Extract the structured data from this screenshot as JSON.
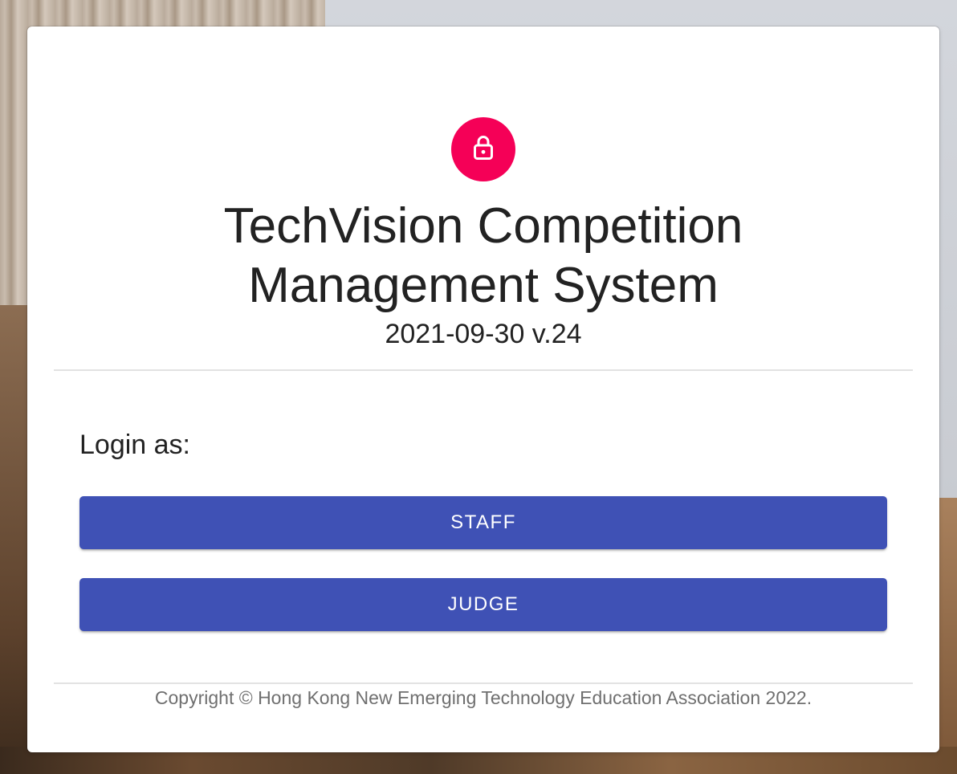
{
  "app": {
    "title_line1": "TechVision Competition",
    "title_line2": "Management System",
    "version": "2021-09-30 v.24"
  },
  "login": {
    "prompt": "Login as:",
    "buttons": [
      {
        "label": "STAFF"
      },
      {
        "label": "JUDGE"
      }
    ]
  },
  "footer": {
    "copyright": "Copyright © Hong Kong New Emerging Technology Education Association 2022."
  },
  "icons": {
    "avatar": "lock-icon"
  },
  "colors": {
    "avatar_bg": "#f50057",
    "button_bg": "#3f51b5",
    "button_text": "#ffffff"
  }
}
